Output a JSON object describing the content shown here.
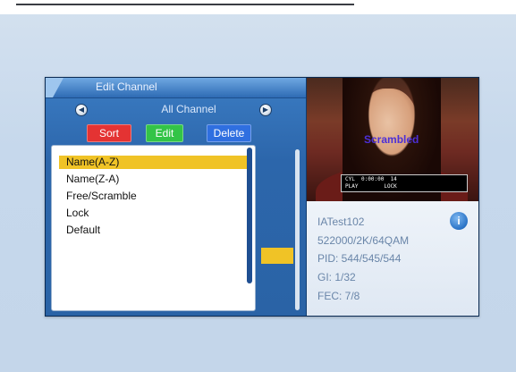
{
  "dialog": {
    "title": "Edit Channel",
    "group": "All Channel",
    "tabs": {
      "sort": "Sort",
      "edit": "Edit",
      "delete": "Delete"
    },
    "sort_options": [
      "Name(A-Z)",
      "Name(Z-A)",
      "Free/Scramble",
      "Lock",
      "Default"
    ],
    "selected_index": 0
  },
  "preview": {
    "overlay_text": "Scrambled",
    "status_line1": "CYL  0:00:00  14",
    "status_line2": "PLAY        LOCK"
  },
  "info": {
    "channel_name": "IATest102",
    "frequency": "522000/2K/64QAM",
    "pid": "PID: 544/545/544",
    "gi": "GI: 1/32",
    "fec": "FEC: 7/8"
  },
  "icons": {
    "nav_left": "left-arrow-icon",
    "nav_right": "right-arrow-icon",
    "info": "info-icon"
  },
  "colors": {
    "sort_tab": "#e43333",
    "edit_tab": "#33c447",
    "delete_tab": "#2f6fe0",
    "selection": "#f0c326",
    "panel": "#2c66ab"
  }
}
